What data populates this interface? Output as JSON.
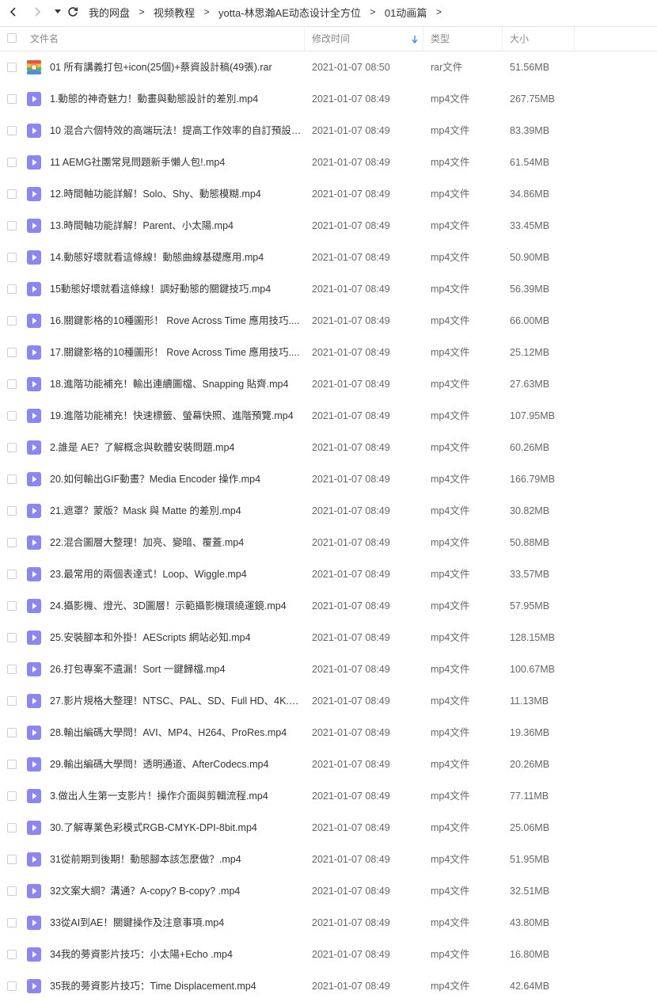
{
  "breadcrumb": [
    "我的网盘",
    "视频教程",
    "yotta-林思瀚AE动态设计全方位",
    "01动画篇"
  ],
  "breadcrumb_sep": ">",
  "columns": {
    "name": "文件名",
    "modified": "修改时间",
    "type": "类型",
    "size": "大小"
  },
  "colors": {
    "video_icon": "#8b86f0",
    "sort_arrow": "#3b8cff",
    "rar_icon_red": "#e8553e",
    "rar_icon_yellow": "#f3c13a",
    "rar_icon_green": "#4cb86a",
    "rar_icon_blue": "#4b8ef1"
  },
  "files": [
    {
      "name": "01 所有講義打包+icon(25個)+蔡資設計稿(49張).rar",
      "time": "2021-01-07 08:50",
      "type": "rar文件",
      "size": "51.56MB",
      "icon": "rar-archive-icon"
    },
    {
      "name": "1.動態的神奇魅力！動畫與動態設計的差別.mp4",
      "time": "2021-01-07 08:49",
      "type": "mp4文件",
      "size": "267.75MB",
      "icon": "video-file-icon"
    },
    {
      "name": "10 混合六個特效的高端玩法！提高工作效率的自訂預設 ...",
      "time": "2021-01-07 08:49",
      "type": "mp4文件",
      "size": "83.39MB",
      "icon": "video-file-icon"
    },
    {
      "name": "11 AEMG社團常見問題新手懶人包!.mp4",
      "time": "2021-01-07 08:49",
      "type": "mp4文件",
      "size": "61.54MB",
      "icon": "video-file-icon"
    },
    {
      "name": "12.時間軸功能詳解！Solo、Shy、動態模糊.mp4",
      "time": "2021-01-07 08:49",
      "type": "mp4文件",
      "size": "34.86MB",
      "icon": "video-file-icon"
    },
    {
      "name": "13.時間軸功能詳解！Parent、小太陽.mp4",
      "time": "2021-01-07 08:49",
      "type": "mp4文件",
      "size": "33.45MB",
      "icon": "video-file-icon"
    },
    {
      "name": "14.動態好壞就看這條線！動態曲線基礎應用.mp4",
      "time": "2021-01-07 08:49",
      "type": "mp4文件",
      "size": "50.90MB",
      "icon": "video-file-icon"
    },
    {
      "name": "15動態好壞就看這條線！調好動態的關鍵技巧.mp4",
      "time": "2021-01-07 08:49",
      "type": "mp4文件",
      "size": "56.39MB",
      "icon": "video-file-icon"
    },
    {
      "name": "16.關鍵影格的10種圖形！ Rove Across Time 應用技巧....",
      "time": "2021-01-07 08:49",
      "type": "mp4文件",
      "size": "66.00MB",
      "icon": "video-file-icon"
    },
    {
      "name": "17.關鍵影格的10種圖形！ Rove Across Time 應用技巧....",
      "time": "2021-01-07 08:49",
      "type": "mp4文件",
      "size": "25.12MB",
      "icon": "video-file-icon"
    },
    {
      "name": "18.進階功能補充！輸出連續圖檔、Snapping 貼齊.mp4",
      "time": "2021-01-07 08:49",
      "type": "mp4文件",
      "size": "27.63MB",
      "icon": "video-file-icon"
    },
    {
      "name": "19.進階功能補充！快速標籤、螢幕快照、進階預覽.mp4",
      "time": "2021-01-07 08:49",
      "type": "mp4文件",
      "size": "107.95MB",
      "icon": "video-file-icon"
    },
    {
      "name": "2.誰是 AE？了解概念與軟體安裝問題.mp4",
      "time": "2021-01-07 08:49",
      "type": "mp4文件",
      "size": "60.26MB",
      "icon": "video-file-icon"
    },
    {
      "name": "20.如何輸出GIF動畫？Media Encoder 操作.mp4",
      "time": "2021-01-07 08:49",
      "type": "mp4文件",
      "size": "166.79MB",
      "icon": "video-file-icon"
    },
    {
      "name": "21.遮罩？蒙版？Mask 與 Matte 的差別.mp4",
      "time": "2021-01-07 08:49",
      "type": "mp4文件",
      "size": "30.82MB",
      "icon": "video-file-icon"
    },
    {
      "name": "22.混合圖層大整理！加亮、變暗、覆蓋.mp4",
      "time": "2021-01-07 08:49",
      "type": "mp4文件",
      "size": "50.88MB",
      "icon": "video-file-icon"
    },
    {
      "name": "23.最常用的兩個表達式！Loop、Wiggle.mp4",
      "time": "2021-01-07 08:49",
      "type": "mp4文件",
      "size": "33.57MB",
      "icon": "video-file-icon"
    },
    {
      "name": "24.攝影機、燈光、3D圖層！示範攝影機環繞運鏡.mp4",
      "time": "2021-01-07 08:49",
      "type": "mp4文件",
      "size": "57.95MB",
      "icon": "video-file-icon"
    },
    {
      "name": "25.安裝腳本和外掛！AEScripts 網站必知.mp4",
      "time": "2021-01-07 08:49",
      "type": "mp4文件",
      "size": "128.15MB",
      "icon": "video-file-icon"
    },
    {
      "name": "26.打包專案不遺漏！Sort 一鍵歸檔.mp4",
      "time": "2021-01-07 08:49",
      "type": "mp4文件",
      "size": "100.67MB",
      "icon": "video-file-icon"
    },
    {
      "name": "27.影片規格大整理！NTSC、PAL、SD、Full HD、4K.m...",
      "time": "2021-01-07 08:49",
      "type": "mp4文件",
      "size": "11.13MB",
      "icon": "video-file-icon"
    },
    {
      "name": "28.輸出編碼大學問！AVI、MP4、H264、ProRes.mp4",
      "time": "2021-01-07 08:49",
      "type": "mp4文件",
      "size": "19.36MB",
      "icon": "video-file-icon"
    },
    {
      "name": "29.輸出編碼大學問！透明通道、AfterCodecs.mp4",
      "time": "2021-01-07 08:49",
      "type": "mp4文件",
      "size": "20.26MB",
      "icon": "video-file-icon"
    },
    {
      "name": "3.做出人生第一支影片！操作介面與剪輯流程.mp4",
      "time": "2021-01-07 08:49",
      "type": "mp4文件",
      "size": "77.11MB",
      "icon": "video-file-icon"
    },
    {
      "name": "30.了解專業色彩模式RGB-CMYK-DPI-8bit.mp4",
      "time": "2021-01-07 08:49",
      "type": "mp4文件",
      "size": "25.06MB",
      "icon": "video-file-icon"
    },
    {
      "name": "31從前期到後期！動態腳本該怎麼做？.mp4",
      "time": "2021-01-07 08:49",
      "type": "mp4文件",
      "size": "51.95MB",
      "icon": "video-file-icon"
    },
    {
      "name": "32文案大綱？溝通？A-copy? B-copy? .mp4",
      "time": "2021-01-07 08:49",
      "type": "mp4文件",
      "size": "32.51MB",
      "icon": "video-file-icon"
    },
    {
      "name": "33從AI到AE！關鍵操作及注意事項.mp4",
      "time": "2021-01-07 08:49",
      "type": "mp4文件",
      "size": "43.80MB",
      "icon": "video-file-icon"
    },
    {
      "name": "34我的蒡資影片技巧：小太陽+Echo .mp4",
      "time": "2021-01-07 08:49",
      "type": "mp4文件",
      "size": "16.80MB",
      "icon": "video-file-icon"
    },
    {
      "name": "35我的蒡資影片技巧：Time Displacement.mp4",
      "time": "2021-01-07 08:49",
      "type": "mp4文件",
      "size": "42.64MB",
      "icon": "video-file-icon"
    }
  ]
}
